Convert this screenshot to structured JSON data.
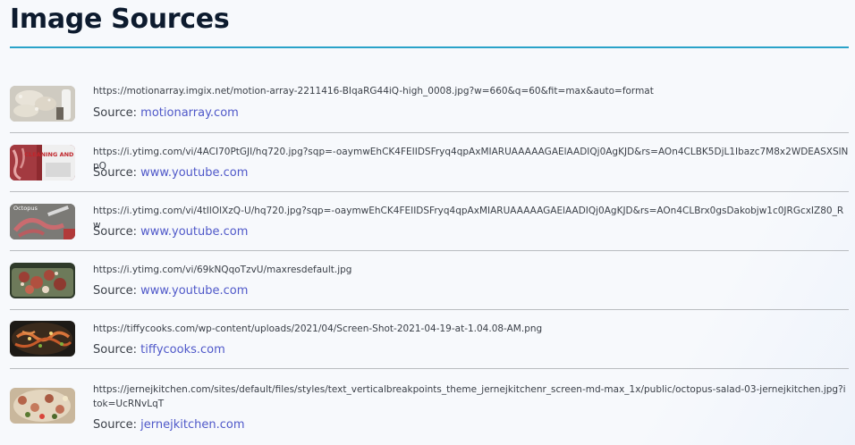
{
  "page": {
    "title": "Image Sources"
  },
  "source_prefix": "Source: ",
  "sources": [
    {
      "image": "octopus-raw-thumbnail",
      "url": "https://motionarray.imgix.net/motion-array-2211416-BIqaRG44iQ-high_0008.jpg?w=660&q=60&fit=max&auto=format",
      "site": "motionarray.com"
    },
    {
      "image": "octopus-cleaning-video-thumbnail",
      "url": "https://i.ytimg.com/vi/4ACI70PtGJI/hq720.jpg?sqp=-oaymwEhCK4FEIIDSFryq4qpAxMIARUAAAAAGAElAADIQj0AgKJD&rs=AOn4CLBK5DjL1Ibazc7M8x2WDEASXSlNpQ",
      "site": "www.youtube.com"
    },
    {
      "image": "octopus-cutting-video-thumbnail",
      "url": "https://i.ytimg.com/vi/4tIlOlXzQ-U/hq720.jpg?sqp=-oaymwEhCK4FEIIDSFryq4qpAxMIARUAAAAAGAElAADIQj0AgKJD&rs=AOn4CLBrx0gsDakobjw1c0JRGcxIZ80_Rw",
      "site": "www.youtube.com"
    },
    {
      "image": "cooked-octopus-thumbnail",
      "url": "https://i.ytimg.com/vi/69kNQqoTzvU/maxresdefault.jpg",
      "site": "www.youtube.com"
    },
    {
      "image": "stir-fried-octopus-thumbnail",
      "url": "https://tiffycooks.com/wp-content/uploads/2021/04/Screen-Shot-2021-04-19-at-1.04.08-AM.png",
      "site": "tiffycooks.com"
    },
    {
      "image": "octopus-salad-thumbnail",
      "url": "https://jernejkitchen.com/sites/default/files/styles/text_verticalbreakpoints_theme_jernejkitchenr_screen-md-max_1x/public/octopus-salad-03-jernejkitchen.jpg?itok=UcRNvLqT",
      "site": "jernejkitchen.com"
    }
  ],
  "thumbnail_text": {
    "cleaning": "CLEANING AND PREP",
    "cutting": "Octopus"
  }
}
